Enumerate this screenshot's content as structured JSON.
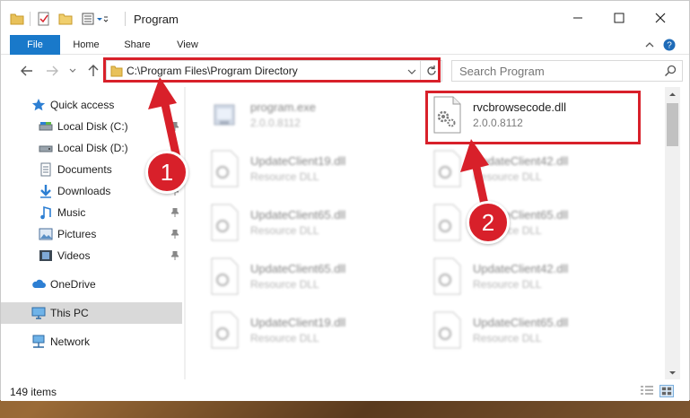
{
  "window": {
    "title": "Program"
  },
  "ribbon": {
    "tabs": [
      {
        "label": "File"
      },
      {
        "label": "Home"
      },
      {
        "label": "Share"
      },
      {
        "label": "View"
      }
    ]
  },
  "address": {
    "path": "C:\\Program Files\\Program Directory"
  },
  "search": {
    "placeholder": "Search Program"
  },
  "sidebar": {
    "items": [
      {
        "label": "Quick access",
        "icon": "star-icon"
      },
      {
        "label": "Local Disk (C:)",
        "icon": "drive-icon"
      },
      {
        "label": "Local Disk (D:)",
        "icon": "drive-icon"
      },
      {
        "label": "Documents",
        "icon": "documents-icon"
      },
      {
        "label": "Downloads",
        "icon": "downloads-icon"
      },
      {
        "label": "Music",
        "icon": "music-icon"
      },
      {
        "label": "Pictures",
        "icon": "pictures-icon"
      },
      {
        "label": "Videos",
        "icon": "videos-icon"
      },
      {
        "label": "OneDrive",
        "icon": "cloud-icon"
      },
      {
        "label": "This PC",
        "icon": "computer-icon"
      },
      {
        "label": "Network",
        "icon": "network-icon"
      }
    ]
  },
  "files": [
    {
      "name": "program.exe",
      "type": "2.0.0.8112",
      "icon": "exe-icon"
    },
    {
      "name": "rvcbrowsecode.dll",
      "type": "2.0.0.8112",
      "icon": "dll-gear-icon"
    },
    {
      "name": "UpdateClient19.dll",
      "type": "Resource DLL"
    },
    {
      "name": "UpdateClient42.dll",
      "type": "Resource DLL"
    },
    {
      "name": "UpdateClient65.dll",
      "type": "Resource DLL"
    },
    {
      "name": "UpdateClient65.dll",
      "type": "Resource DLL"
    },
    {
      "name": "UpdateClient65.dll",
      "type": "Resource DLL"
    },
    {
      "name": "UpdateClient42.dll",
      "type": "Resource DLL"
    },
    {
      "name": "UpdateClient19.dll",
      "type": "Resource DLL"
    },
    {
      "name": "UpdateClient65.dll",
      "type": "Resource DLL"
    }
  ],
  "status": {
    "count": "149 items"
  },
  "annotations": {
    "step1": "1",
    "step2": "2",
    "color": "#d8202a"
  },
  "colors": {
    "file_tab": "#1979ca",
    "highlight": "#d8202a",
    "selected_nav": "#d9d9d9"
  }
}
